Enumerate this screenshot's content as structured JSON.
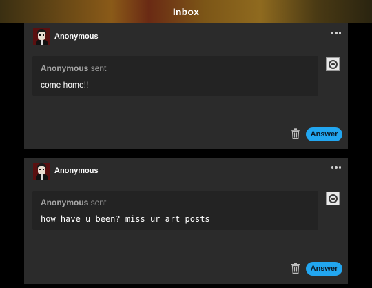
{
  "header": {
    "title": "Inbox"
  },
  "cards": [
    {
      "author": "Anonymous",
      "sender_name": "Anonymous",
      "sender_suffix": "sent",
      "message": "come home!!",
      "answer_label": "Answer"
    },
    {
      "author": "Anonymous",
      "sender_name": "Anonymous",
      "sender_suffix": "sent",
      "message": "how have u been? miss ur art posts",
      "answer_label": "Answer"
    }
  ],
  "colors": {
    "accent": "#22a6f0",
    "card_bg": "#2b2b2b",
    "bubble_bg": "#232323"
  }
}
